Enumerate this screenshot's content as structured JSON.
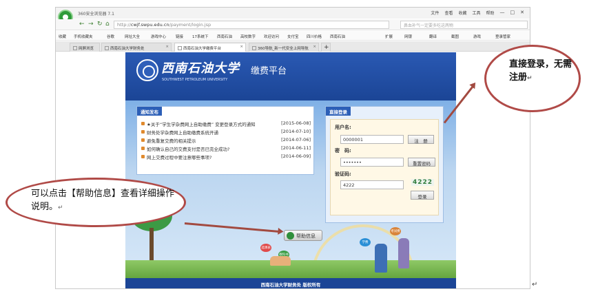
{
  "browser": {
    "title": "360安全浏览器 7.1",
    "menu": [
      "文件",
      "查看",
      "收藏",
      "工具",
      "帮助"
    ],
    "window_controls": [
      "—",
      "□",
      "✕"
    ],
    "address": {
      "prefix": "http://",
      "host": "cwjf.swpu.edu.cn",
      "path": "/payment/login.jsp"
    },
    "search_placeholder": "鼻血补气一定要多吃这两物",
    "bookmarks": [
      "收藏",
      "手机收藏夹",
      "谷歌",
      "网址大全",
      "游戏中心",
      "链接",
      "17系统下",
      "西南石油",
      "高校数字",
      "欢迎访问",
      "支付宝",
      "四川价格",
      "西南石油"
    ],
    "bookmarks_right": [
      "扩展",
      "网银",
      "翻译",
      "截图",
      "游戏",
      "登录管家"
    ],
    "tabs": [
      {
        "label": "网屏浏览"
      },
      {
        "label": "西南石油大学财务处"
      },
      {
        "label": "西南石油大学缴费平台"
      },
      {
        "label": "360导航_新一代安全上网导航"
      }
    ]
  },
  "site": {
    "uni_name_cn": "西南石油大学",
    "uni_name_en": "SOUTHWEST PETROLEUM UNIVERSITY",
    "platform_title": "缴费平台",
    "news": {
      "heading": "通知发布",
      "items": [
        {
          "title": "★关于“学生学杂费网上自助缴费” 变更登录方式的通知",
          "date": "[2015-06-08]"
        },
        {
          "title": "财务处学杂费网上自助缴费系统开通",
          "date": "[2014-07-10]"
        },
        {
          "title": "避免重复交费的相关提示",
          "date": "[2014-07-06]"
        },
        {
          "title": "如何确认自己的交费支付是否已完全成功?",
          "date": "[2014-06-11]"
        },
        {
          "title": "网上交费过程中要注意哪些事项?",
          "date": "[2014-06-09]"
        }
      ]
    },
    "login": {
      "heading": "直接登录",
      "username_label": "用户名:",
      "username_value": "0000001",
      "password_label": "密　码:",
      "password_value": "•••••••",
      "captcha_label": "验证码:",
      "captcha_input": "4222",
      "captcha_image": "4222",
      "register_button": "注　册",
      "reset_password_button": "重置密码",
      "login_button": "登录"
    },
    "help_button": "帮助信息",
    "bubbles": [
      "选课表",
      "学费",
      "教科书",
      "考试费"
    ],
    "footer": "西南石油大学财务处 版权所有"
  },
  "callouts": {
    "right": "直接登录，无需注册",
    "left": "可以点击【帮助信息】查看详细操作说明。",
    "return_mark": "↵"
  },
  "colors": {
    "header_blue": "#1b4596",
    "callout_border": "#b04a47",
    "arrow": "#a24a40"
  }
}
